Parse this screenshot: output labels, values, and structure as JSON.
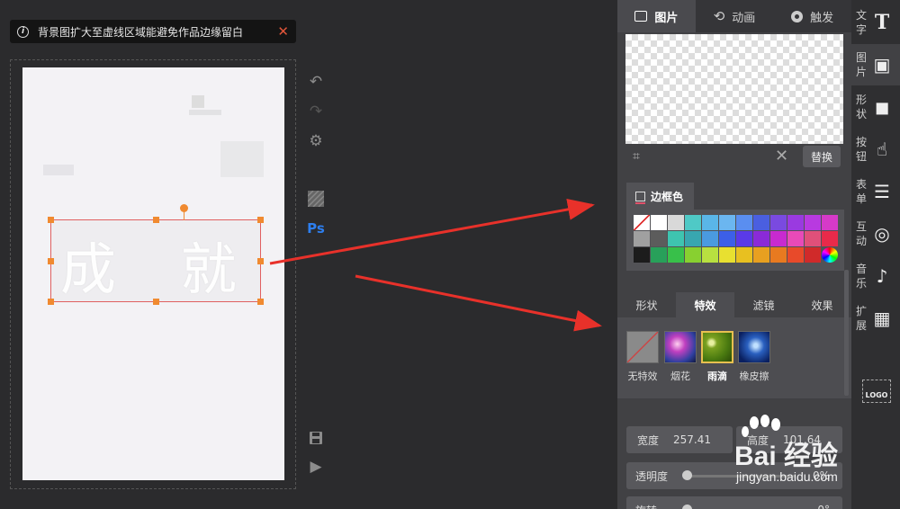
{
  "notice": {
    "text": "背景图扩大至虚线区域能避免作品边缘留白",
    "close": "✕"
  },
  "canvas": {
    "selected_text": "成 就"
  },
  "panel": {
    "tabs": [
      {
        "label": "图片",
        "icon": "image-icon"
      },
      {
        "label": "动画",
        "icon": "loop-icon"
      },
      {
        "label": "触发",
        "icon": "target-icon"
      }
    ],
    "replace_label": "替换",
    "border_color_label": "边框色",
    "palette": [
      "none",
      "#ffffff",
      "#d9d9d9",
      "#4fc9c6",
      "#5ab6e8",
      "#6bb6f0",
      "#5a8ef0",
      "#4a5fe0",
      "#7a4ae0",
      "#9a3ae0",
      "#b83ae0",
      "#d63ac8",
      "#a0a0a0",
      "#5c5c5c",
      "#3ec4b0",
      "#38a6b0",
      "#4a9ae0",
      "#3c5fe8",
      "#5a3ae8",
      "#8a2ad8",
      "#c82ad0",
      "#e84ab8",
      "#e0507a",
      "#e82a4a",
      "#1c1c1c",
      "#28a05a",
      "#38c04a",
      "#88d030",
      "#b8e040",
      "#e8e030",
      "#e8c020",
      "#e8a020",
      "#e87a20",
      "#e84a2a",
      "#d02a2a",
      "rainbow"
    ],
    "fx_tabs": [
      "形状",
      "特效",
      "滤镜",
      "效果"
    ],
    "fx_active": 1,
    "effects": [
      {
        "label": "无特效",
        "thumb": "none"
      },
      {
        "label": "烟花",
        "thumb": "fireworks"
      },
      {
        "label": "雨滴",
        "thumb": "raindrops"
      },
      {
        "label": "橡皮擦",
        "thumb": "eraser"
      }
    ],
    "fx_selected": 2,
    "width_label": "宽度",
    "width_value": "257.41",
    "height_label": "高度",
    "height_value": "101.64",
    "opacity_label": "透明度",
    "opacity_value": "0%",
    "rotate_label": "旋转",
    "rotate_value": "0°"
  },
  "sidebar": [
    {
      "label": "文字",
      "icon": "text-icon"
    },
    {
      "label": "图片",
      "icon": "image-icon"
    },
    {
      "label": "形状",
      "icon": "shapes-icon"
    },
    {
      "label": "按钮",
      "icon": "tap-icon"
    },
    {
      "label": "表单",
      "icon": "form-icon"
    },
    {
      "label": "互动",
      "icon": "fingerprint-icon"
    },
    {
      "label": "音乐",
      "icon": "music-icon"
    },
    {
      "label": "扩展",
      "icon": "grid-icon"
    }
  ],
  "sidebar_active": 1,
  "logo_label": "LOGO",
  "watermark": {
    "brand": "Bai  经验",
    "url": "jingyan.baidu.com"
  },
  "colors": {
    "accent": "#f08a30",
    "arrow": "#e8312a",
    "panel": "#414144"
  }
}
